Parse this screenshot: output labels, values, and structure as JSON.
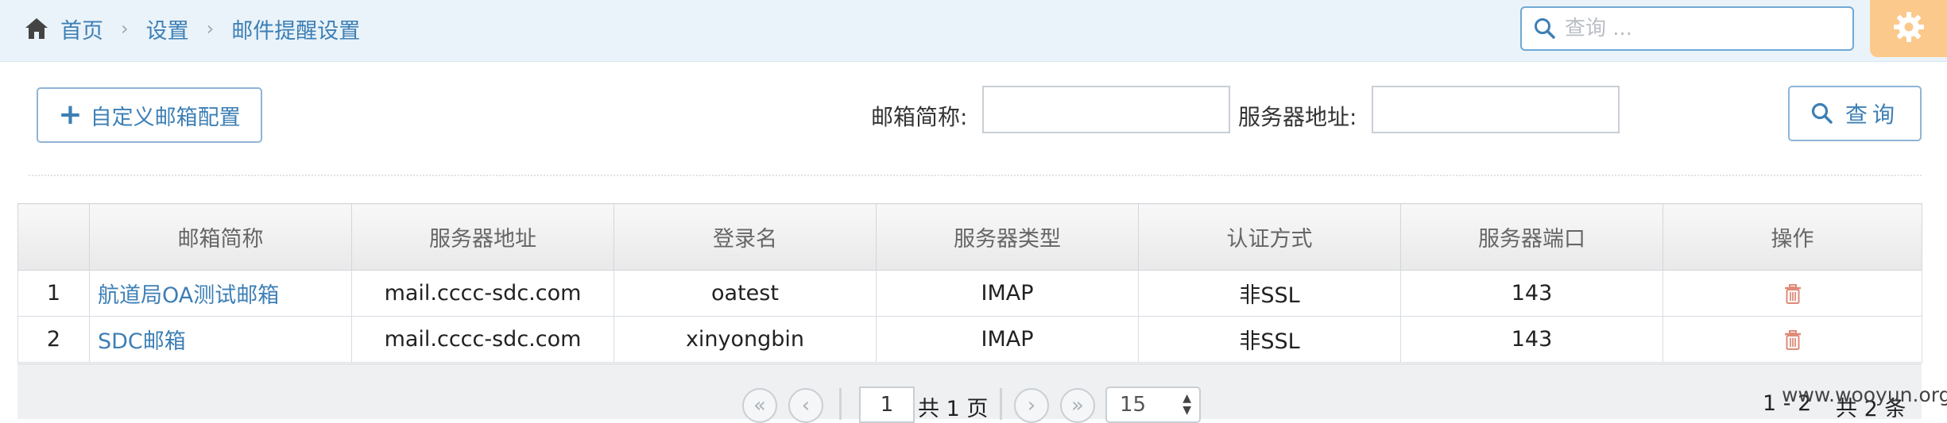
{
  "breadcrumb": {
    "items": [
      "首页",
      "设置",
      "邮件提醒设置"
    ]
  },
  "search": {
    "placeholder": "查询 ..."
  },
  "toolbar": {
    "add_label": "自定义邮箱配置",
    "filter_name_label": "邮箱简称:",
    "filter_server_label": "服务器地址:",
    "filter_name_value": "",
    "filter_server_value": "",
    "query_label": "查询"
  },
  "table": {
    "headers": [
      "",
      "邮箱简称",
      "服务器地址",
      "登录名",
      "服务器类型",
      "认证方式",
      "服务器端口",
      "操作"
    ],
    "rows": [
      {
        "index": "1",
        "name": "航道局OA测试邮箱",
        "server": "mail.cccc-sdc.com",
        "login": "oatest",
        "type": "IMAP",
        "auth": "非SSL",
        "port": "143"
      },
      {
        "index": "2",
        "name": "SDC邮箱",
        "server": "mail.cccc-sdc.com",
        "login": "xinyongbin",
        "type": "IMAP",
        "auth": "非SSL",
        "port": "143"
      }
    ]
  },
  "pager": {
    "current_page": "1",
    "total_pages_text": "共 1 页",
    "page_size": "15",
    "range_text": "1 - 2",
    "total_text": "共 2 条"
  },
  "watermark": "www.wooyun.org",
  "colors": {
    "accent": "#3d7fb5",
    "topbar": "#eaf3f9",
    "gear_bg": "#fbc98b",
    "delete": "#e08a78"
  },
  "icons": [
    "home-icon",
    "search-icon",
    "gear-icon",
    "plus-icon",
    "trash-icon",
    "first-page-icon",
    "prev-page-icon",
    "next-page-icon",
    "last-page-icon"
  ]
}
